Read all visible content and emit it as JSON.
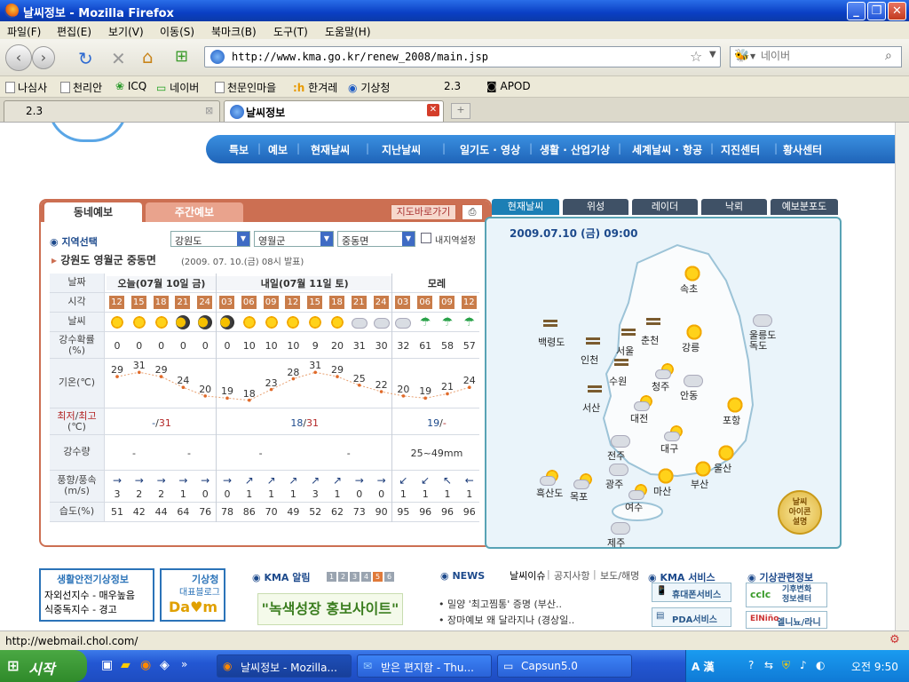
{
  "window": {
    "title": "날씨정보 - Mozilla Firefox"
  },
  "menu": [
    "파일(F)",
    "편집(E)",
    "보기(V)",
    "이동(S)",
    "북마크(B)",
    "도구(T)",
    "도움말(H)"
  ],
  "address": {
    "url": "http://www.kma.go.kr/renew_2008/main.jsp"
  },
  "search": {
    "placeholder": "네이버"
  },
  "bookmarks": [
    "나심사",
    "천리안",
    "ICQ",
    "네이버",
    "천문인마을",
    "한겨레",
    "기상청",
    "2.3",
    "APOD"
  ],
  "tabs": [
    {
      "label": "2.3"
    },
    {
      "label": "날씨정보"
    }
  ],
  "tooltip": {
    "line1": "천리안",
    "line2": "http://webmail.chol.com/"
  },
  "site_nav": [
    "특보",
    "예보",
    "현재날씨",
    "지난날씨",
    "일기도 · 영상",
    "생활 · 산업기상",
    "세계날씨 · 항공",
    "지진센터",
    "황사센터"
  ],
  "forecast": {
    "tabs": [
      "동네예보",
      "주간예보"
    ],
    "map_button": "지도바로가기",
    "region_label": "지역선택",
    "selects": [
      "강원도",
      "영월군",
      "중동면"
    ],
    "wide_label": "내지역설정",
    "location": "강원도 영월군 중동면",
    "issued": "(2009. 07. 10.(금) 08시 발표)",
    "row_labels": {
      "date": "날짜",
      "time": "시각",
      "weather": "날씨",
      "pop": "강수확률\n(%)",
      "temp": "기온(℃)",
      "minmax_a": "최저",
      "minmax_sep": "/",
      "minmax_b": "최고",
      "minmax_unit": "(℃)",
      "rain": "강수량",
      "wind": "풍향/풍속\n(m/s)",
      "humid": "습도(%)"
    },
    "days": [
      "오늘(07월 10일 금)",
      "내일(07월 11일 토)",
      "모레"
    ],
    "hours": [
      "12",
      "15",
      "18",
      "21",
      "24",
      "03",
      "06",
      "09",
      "12",
      "15",
      "18",
      "21",
      "24",
      "03",
      "06",
      "09",
      "12"
    ],
    "weather": [
      "sun",
      "sun",
      "sun",
      "moon",
      "moon",
      "moon",
      "sun",
      "sun",
      "sun",
      "sun",
      "sun",
      "cloud",
      "cloud",
      "cloud",
      "umb",
      "umb",
      "umb"
    ],
    "pop": [
      "0",
      "0",
      "0",
      "0",
      "0",
      "0",
      "10",
      "10",
      "10",
      "9",
      "20",
      "31",
      "30",
      "32",
      "61",
      "58",
      "57"
    ],
    "temps": [
      "29",
      "31",
      "29",
      "24",
      "20",
      "19",
      "18",
      "23",
      "28",
      "31",
      "29",
      "25",
      "22",
      "20",
      "19",
      "21",
      "24"
    ],
    "minmax": [
      {
        "a": "-",
        "b": "31"
      },
      {
        "a": "18",
        "b": "31"
      },
      {
        "a": "19",
        "b": "-"
      }
    ],
    "rain": [
      "-",
      "-",
      "-",
      "-",
      "25~49mm"
    ],
    "wind_arrows": [
      "→",
      "→",
      "→",
      "→",
      "→",
      "→",
      "↗",
      "↗",
      "↗",
      "↗",
      "↗",
      "→",
      "→",
      "↙",
      "↙",
      "↖",
      "←"
    ],
    "wind_speed": [
      "3",
      "2",
      "2",
      "1",
      "0",
      "0",
      "1",
      "1",
      "1",
      "3",
      "1",
      "0",
      "0",
      "1",
      "1",
      "1",
      "1"
    ],
    "humidity": [
      "51",
      "42",
      "44",
      "64",
      "76",
      "78",
      "86",
      "70",
      "49",
      "52",
      "62",
      "73",
      "90",
      "95",
      "96",
      "96",
      "96"
    ]
  },
  "map": {
    "tabs": [
      "현재날씨",
      "위성",
      "레이더",
      "낙뢰",
      "예보분포도"
    ],
    "datetime": "2009.07.10 (금) 09:00",
    "cities": [
      "속초",
      "백령도",
      "춘천",
      "서울",
      "강릉",
      "울릉도\n독도",
      "인천",
      "수원",
      "청주",
      "안동",
      "서산",
      "대전",
      "포항",
      "전주",
      "대구",
      "울산",
      "흑산도",
      "목포",
      "광주",
      "마산",
      "부산",
      "여수",
      "제주"
    ],
    "icon_badge": "날씨\n아이콘\n설명"
  },
  "bottom": {
    "safety_title": "생활안전기상정보",
    "safety_line1": "자외선지수 - 매우높음",
    "safety_line2": "식중독지수 - 경고",
    "blog_title": "기상청",
    "blog_sub": "대표블로그",
    "kma_notice": "KMA 알림",
    "pages": [
      "1",
      "2",
      "3",
      "4",
      "5",
      "6"
    ],
    "green_banner": "\"녹색성장 홍보사이트\"",
    "news_title": "NEWS",
    "news_tabs": [
      "날씨이슈",
      "공지사항",
      "보도/해명"
    ],
    "news_items": [
      "밀양 '최고찜통' 증명 (부산..",
      "장마예보 왜 달라지나 (경상일.."
    ],
    "kma_service": "KMA 서비스",
    "svc1": "휴대폰서비스",
    "svc2": "PDA서비스",
    "related": "기상관련정보",
    "rel1": "기후변화\n정보센터",
    "rel2": "엘니뇨/라니냐"
  },
  "status": {
    "text": "http://webmail.chol.com/"
  },
  "taskbar": {
    "start": "시작",
    "buttons": [
      "날씨정보 - Mozilla...",
      "받은 편지함 - Thu...",
      "Capsun5.0"
    ],
    "ime": "A 漢",
    "clock": "오전 9:50"
  }
}
